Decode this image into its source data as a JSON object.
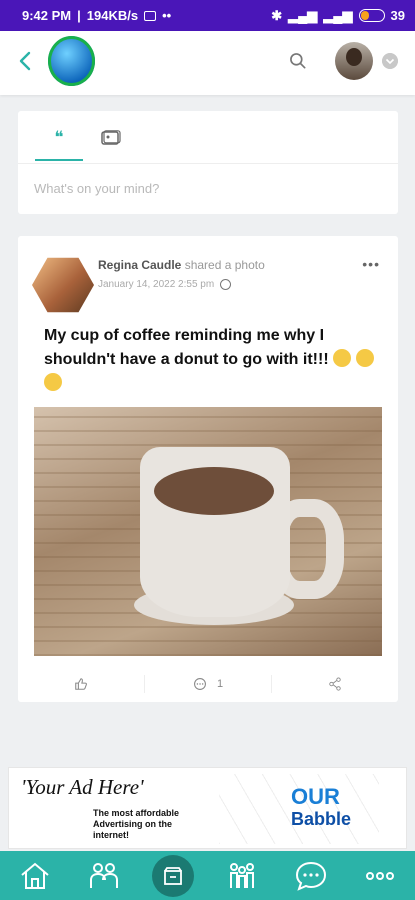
{
  "status_bar": {
    "time": "9:42 PM",
    "speed": "194KB/s",
    "battery": "39"
  },
  "app_bar": {
    "back_icon": "chevron-left-icon",
    "logo_icon": "globe-logo",
    "search_icon": "search-icon",
    "account_icon": "avatar",
    "menu_icon": "chevron-down-icon"
  },
  "composer": {
    "tabs": [
      {
        "icon": "quote-icon",
        "active": true
      },
      {
        "icon": "photo-icon",
        "active": false
      }
    ],
    "placeholder": "What's on your mind?"
  },
  "post": {
    "author": "Regina Caudle",
    "action": "shared a photo",
    "date": "January 14, 2022 2:55 pm",
    "privacy_icon": "globe-icon",
    "text": "My cup of coffee reminding me why I shouldn't have a donut to go with it!!!",
    "comments_count": "1",
    "actions": [
      {
        "icon": "like-icon",
        "count": ""
      },
      {
        "icon": "comment-icon",
        "count": "1"
      },
      {
        "icon": "share-icon",
        "count": ""
      }
    ]
  },
  "ad": {
    "title": "'Your Ad Here'",
    "subtitle": "The most affordable Advertising on the internet!",
    "brand_top": "OUR",
    "brand_bottom": "Babble"
  },
  "bottom_nav": [
    {
      "icon": "home-icon"
    },
    {
      "icon": "friends-icon"
    },
    {
      "icon": "store-icon"
    },
    {
      "icon": "groups-icon"
    },
    {
      "icon": "chat-icon"
    },
    {
      "icon": "more-icon"
    }
  ],
  "colors": {
    "status_bar": "#4a16b8",
    "accent": "#2bb3a8",
    "nav_center": "#1b7a72"
  }
}
